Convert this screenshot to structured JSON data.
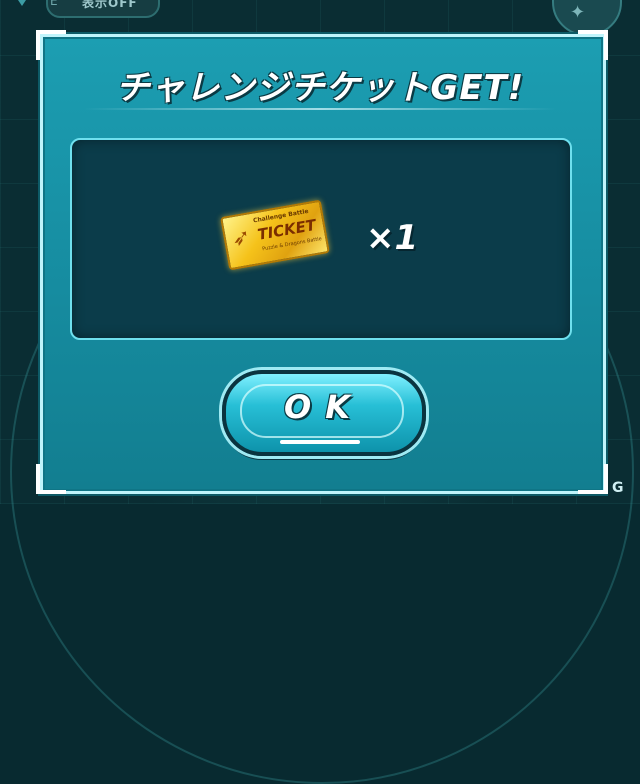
{
  "hud": {
    "display_toggle_label": "表示OFF",
    "small_mark": "E"
  },
  "dialog": {
    "title": "チャレンジチケットGET!",
    "reward": {
      "ticket_small_text": "Challenge Battle",
      "ticket_label": "TICKET",
      "ticket_sub_text": "Puzzle & Dragons Battle",
      "quantity": "×1"
    },
    "ok_label": "OK"
  },
  "watermark": "G"
}
